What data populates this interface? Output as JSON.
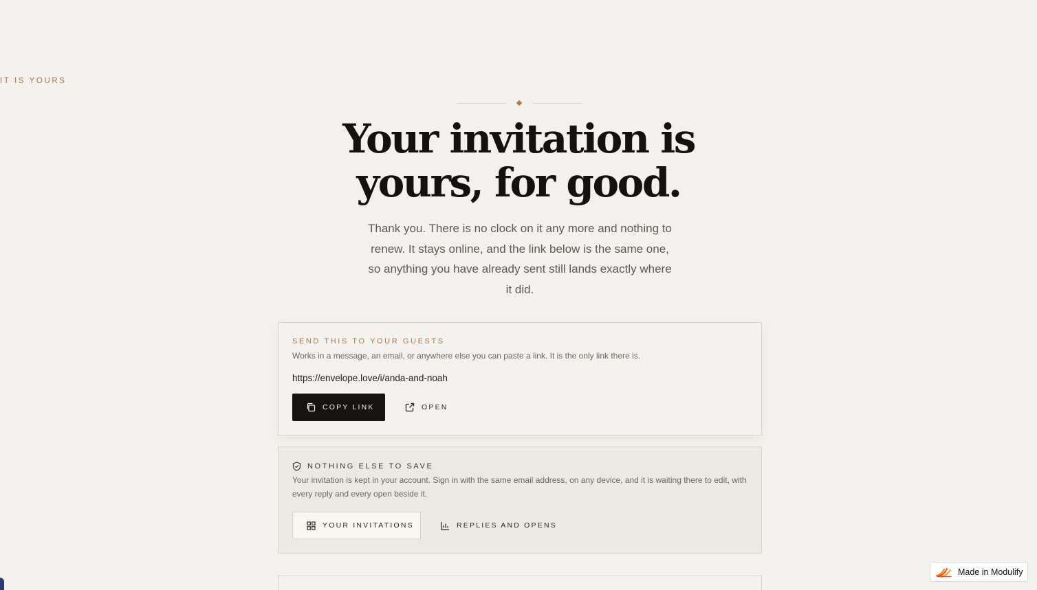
{
  "hero": {
    "eyebrow": "IT IS YOURS",
    "headline": "Your invitation is yours, for good.",
    "lede": "Thank you. There is no clock on it any more and nothing to renew. It stays online, and the link below is the same one, so anything you have already sent still lands exactly where it did."
  },
  "send_card": {
    "label": "SEND THIS TO YOUR GUESTS",
    "description": "Works in a message, an email, or anywhere else you can paste a link. It is the only link there is.",
    "url": "https://envelope.love/i/anda-and-noah",
    "copy_label": "COPY LINK",
    "open_label": "OPEN"
  },
  "save_card": {
    "label": "NOTHING ELSE TO SAVE",
    "description": "Your invitation is kept in your account. Sign in with the same email address, on any device, and it is waiting there to edit, with every reply and every open beside it.",
    "invitations_label": "YOUR INVITATIONS",
    "replies_label": "REPLIES AND OPENS"
  },
  "badge": {
    "label": "Made in Modulify"
  },
  "colors": {
    "background": "#f3f1ed",
    "accent": "#a6774e",
    "dark_button": "#161412",
    "text": "#141210"
  },
  "icons": {
    "copy": "copy-icon",
    "open": "external-link-icon",
    "shield": "shield-check-icon",
    "grid": "grid-icon",
    "chart": "bar-chart-icon",
    "logo": "modulify-logo-icon"
  }
}
